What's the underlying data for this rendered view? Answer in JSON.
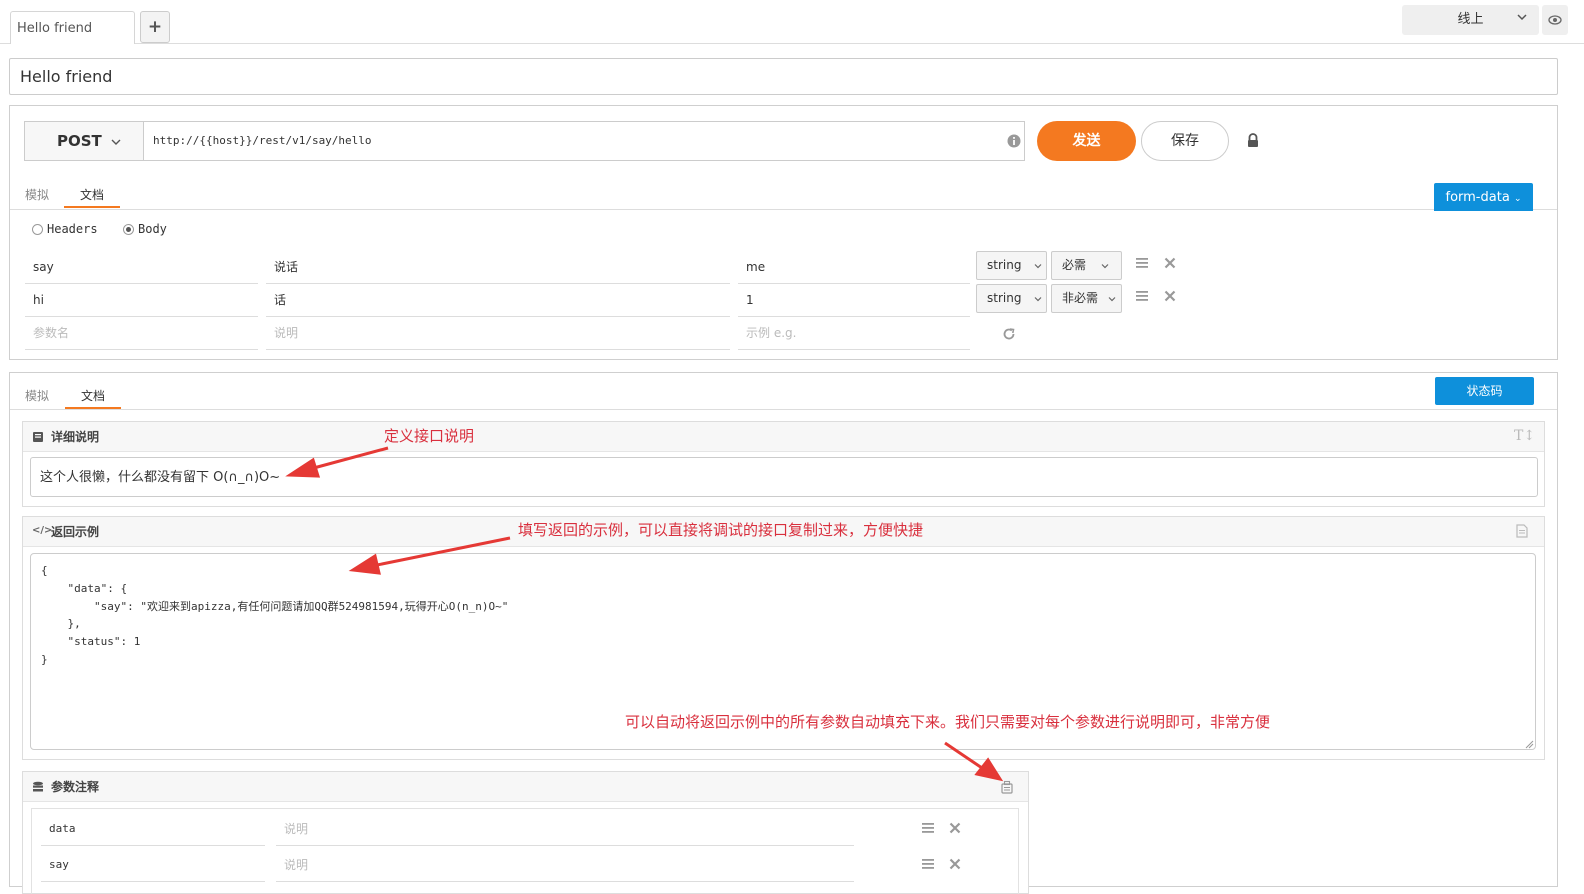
{
  "tabs": {
    "current": "Hello friend",
    "add": "+"
  },
  "env": {
    "selected": "线上"
  },
  "api": {
    "title": "Hello friend",
    "method": "POST",
    "url": "http://{{host}}/rest/v1/say/hello",
    "send_label": "发送",
    "save_label": "保存"
  },
  "request": {
    "tabs": [
      "模拟",
      "文档"
    ],
    "active_tab": "文档",
    "body_type": "form-data",
    "radios": [
      "Headers",
      "Body"
    ],
    "radio_selected": "Body",
    "params": [
      {
        "name": "say",
        "desc": "说话",
        "example": "me",
        "type": "string",
        "required": "必需"
      },
      {
        "name": "hi",
        "desc": "话",
        "example": "1",
        "type": "string",
        "required": "非必需"
      }
    ],
    "new_row": {
      "name_ph": "参数名",
      "desc_ph": "说明",
      "example_ph": "示例 e.g."
    }
  },
  "response": {
    "tabs": [
      "模拟",
      "文档"
    ],
    "active_tab": "文档",
    "status_btn": "状态码",
    "detail_title": "详细说明",
    "detail_text": "这个人很懒，什么都没有留下 O(∩_∩)O~",
    "example_title": "返回示例",
    "example_code": "{\n    \"data\": {\n        \"say\": \"欢迎来到apizza,有任何问题请加QQ群524981594,玩得开心O(n_n)O~\"\n    },\n    \"status\": 1\n}",
    "notes_title": "参数注释",
    "notes": [
      {
        "name": "data",
        "desc_ph": "说明"
      },
      {
        "name": "say",
        "desc_ph": "说明"
      }
    ]
  },
  "annotations": {
    "a1": "定义接口说明",
    "a2": "填写返回的示例，可以直接将调试的接口复制过来，方便快捷",
    "a3": "可以自动将返回示例中的所有参数自动填充下来。我们只需要对每个参数进行说明即可，非常方便"
  },
  "colors": {
    "accent": "#f47920",
    "primary": "#0e90db",
    "annotation": "#d9303e"
  }
}
